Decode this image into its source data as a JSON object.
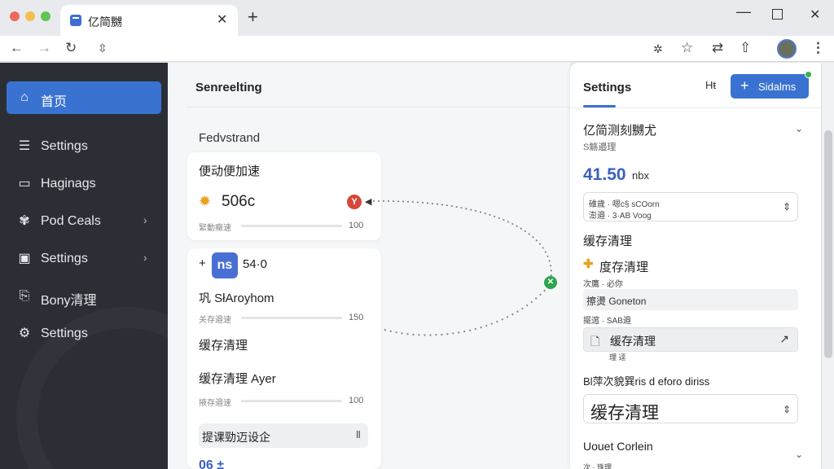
{
  "browser": {
    "tab_title": "亿简嬲",
    "tab_close": "✕",
    "new_tab": "+",
    "win_min": "—",
    "win_close": "✕"
  },
  "toolbar": {
    "back": "←",
    "forward": "→",
    "reload": "↻",
    "site_info": "⇳",
    "extensions": "✲",
    "bookmark": "☆",
    "share": "⇄",
    "pin": "⇧",
    "menu": "⋮"
  },
  "sidebar": {
    "items": [
      {
        "label": "首页",
        "icon": "⌂",
        "active": true
      },
      {
        "label": "Settings",
        "icon": "☰"
      },
      {
        "label": "Haginags",
        "icon": "▭"
      },
      {
        "label": "Pod Ceals",
        "icon": "✾",
        "chevron": "›"
      },
      {
        "label": "Settings",
        "icon": "▣",
        "chevron": "›"
      },
      {
        "label": "Bony清理",
        "icon": "⎘"
      },
      {
        "label": "Settings",
        "icon": "⚙"
      }
    ]
  },
  "main": {
    "title": "Senreelting",
    "section": "Fedvstrand",
    "card1": {
      "heading": "便动便加速",
      "value": "506c",
      "alert": "Y",
      "meter_label": "緊動癥速",
      "meter_value": "100",
      "meter_fraction": 0.35
    },
    "card2": {
      "plus": "+",
      "badge": "ns",
      "badge_value": "54·0",
      "subheading": "巩 SłAroyhom",
      "meter1_label": "关存邉速",
      "meter1_value": "150",
      "heading2": "缓存清理",
      "heading3": "缓存清理 Ayer",
      "meter2_label": "掖存邉速",
      "meter2_value": "100",
      "input": "提课勁迈设企",
      "input_icon": "II",
      "bottom": "06 ±"
    },
    "connector_dot": "✕"
  },
  "panel": {
    "title": "Settings",
    "hl": "Hŧ",
    "add_button": "Sidalms",
    "add_plus": "+",
    "heading1": "亿简测刻嬲尤",
    "sub1": "S觞邉理",
    "chevron": "⌄",
    "stat_value": "41.50",
    "stat_unit": "nbx",
    "field1_line1": "碓歲 · 嗯c§ sCOorn",
    "field1_line2": "澎邉 · 3·AB Voog",
    "sort": "⇕",
    "heading2": "缓存清理",
    "plus": "✚",
    "heading3": "度存清理",
    "mini1": "次鷹 · 必你",
    "row1": "擦燙 Goneton",
    "mini2": "擺逭 · SAB邉",
    "row2": "缓存清理",
    "row2_sub": "↗",
    "row2_go": "↗",
    "mini3": "理 迳",
    "heading4": "Bl萍次貌巽ris d eforo diriss",
    "big_field": "缓存清理",
    "heading5": "Uouet Corlein",
    "bottom_mini": "次 · 珠理"
  }
}
